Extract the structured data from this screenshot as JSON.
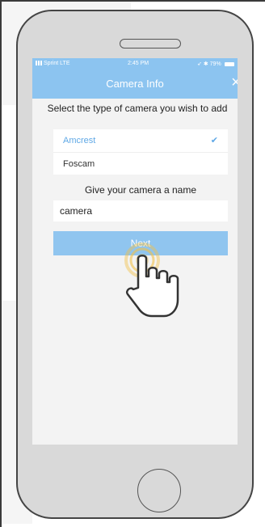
{
  "status_bar": {
    "carrier": "Sprint LTE",
    "time": "2:45 PM",
    "battery": "79%"
  },
  "header": {
    "title": "Camera Info",
    "close_icon": "close-icon"
  },
  "camera_type": {
    "prompt": "Select the type of camera you wish to add",
    "options": [
      {
        "label": "Amcrest",
        "selected": true
      },
      {
        "label": "Foscam",
        "selected": false
      }
    ]
  },
  "camera_name": {
    "prompt": "Give your camera a name",
    "value": "camera"
  },
  "next_label": "Next",
  "colors": {
    "accent": "#8cc4f0",
    "selected_text": "#5fa8e6",
    "tap_ring": "#f1c24a"
  },
  "icons": [
    "signal-icon",
    "location-icon",
    "bluetooth-icon",
    "battery-icon",
    "check-icon",
    "tap-hand-icon"
  ]
}
